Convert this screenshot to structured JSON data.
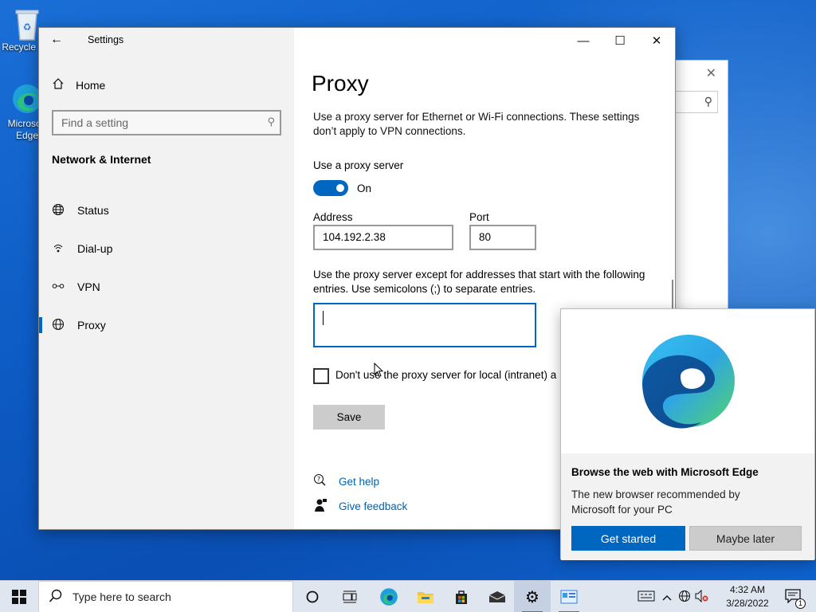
{
  "desktop": {
    "icons": [
      {
        "label": "Recycle Bin"
      },
      {
        "label": "Microsoft Edge"
      }
    ]
  },
  "settings": {
    "window_title": "Settings",
    "home_label": "Home",
    "search_placeholder": "Find a setting",
    "section_title": "Network & Internet",
    "nav_items": [
      {
        "label": "Status",
        "icon": "globe-icon"
      },
      {
        "label": "Dial-up",
        "icon": "dialup-icon"
      },
      {
        "label": "VPN",
        "icon": "vpn-icon"
      },
      {
        "label": "Proxy",
        "icon": "globe-icon",
        "active": true
      }
    ],
    "page_title": "Proxy",
    "description": "Use a proxy server for Ethernet or Wi-Fi connections. These settings don’t apply to VPN connections.",
    "use_proxy_label": "Use a proxy server",
    "toggle_state": "On",
    "address_label": "Address",
    "address_value": "104.192.2.38",
    "port_label": "Port",
    "port_value": "80",
    "exceptions_label": "Use the proxy server except for addresses that start with the following entries. Use semicolons (;) to separate entries.",
    "exceptions_value": "",
    "local_checkbox_label": "Don't use the proxy server for local (intranet) a",
    "save_label": "Save",
    "help_label": "Get help",
    "feedback_label": "Give feedback"
  },
  "promo": {
    "title": "Browse the web with Microsoft Edge",
    "text": "The new browser recommended by Microsoft for your PC",
    "primary_label": "Get started",
    "secondary_label": "Maybe later"
  },
  "taskbar": {
    "search_placeholder": "Type here to search",
    "time": "4:32 AM",
    "date": "3/28/2022",
    "notification_count": "1"
  },
  "colors": {
    "accent": "#0067c0",
    "desktop": "#0d5bc4",
    "sidebar": "#f2f2f2",
    "link": "#0063b1"
  }
}
